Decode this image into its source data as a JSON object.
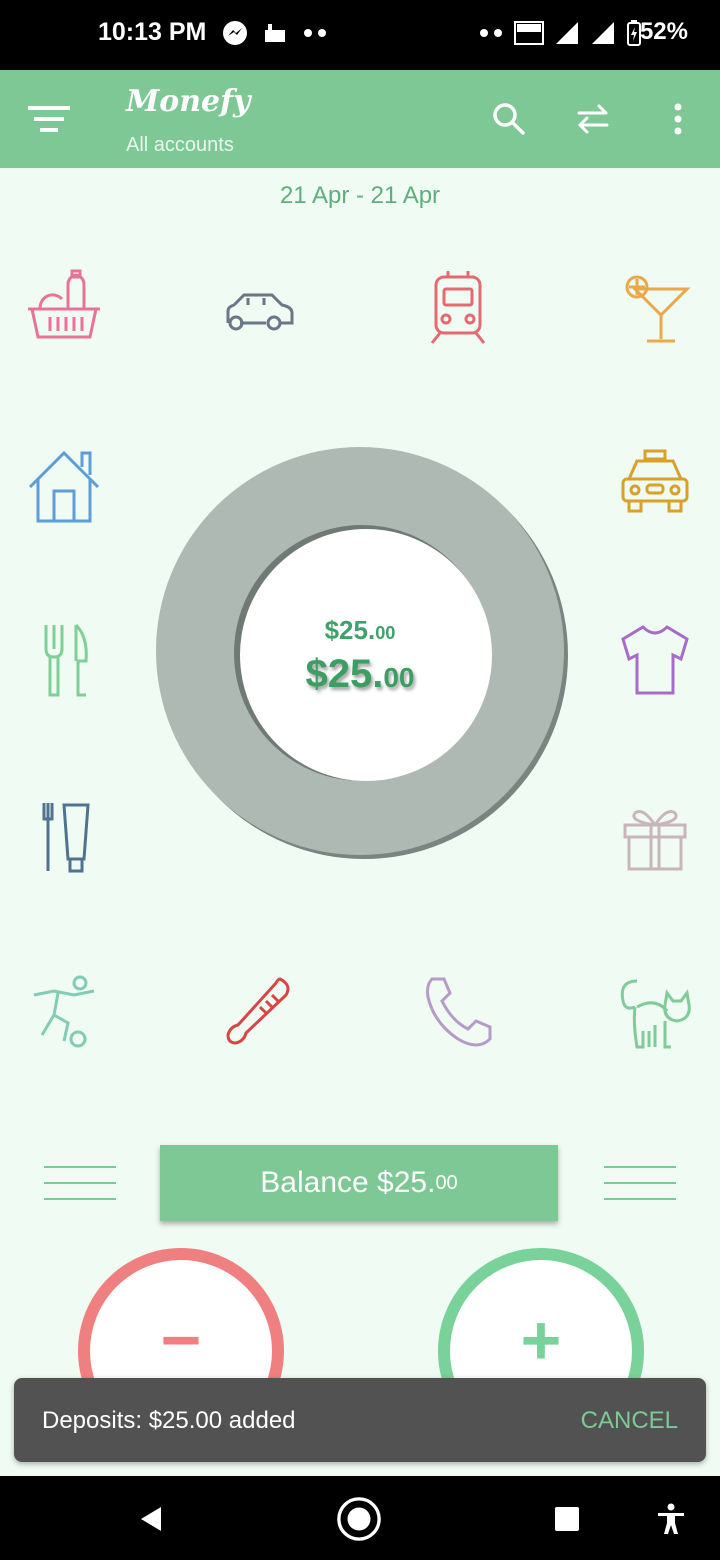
{
  "status_bar": {
    "time": "10:13 PM",
    "battery": "52%",
    "left_icons": [
      "messenger-icon",
      "notification-icon",
      "more-dots-icon"
    ],
    "right_icons": [
      "more-dots-icon",
      "volte-icon",
      "signal-icon",
      "signal-icon",
      "battery-charging-icon"
    ]
  },
  "app_bar": {
    "title": "Monefy",
    "subtitle": "All accounts",
    "actions": [
      "search-icon",
      "transfer-icon",
      "more-vert-icon"
    ]
  },
  "date_range": "21 Apr - 21 Apr",
  "categories": [
    {
      "name": "groceries",
      "icon": "basket-icon",
      "color": "#e8739a"
    },
    {
      "name": "car",
      "icon": "car-icon",
      "color": "#6b7689"
    },
    {
      "name": "transport",
      "icon": "train-icon",
      "color": "#e46a72"
    },
    {
      "name": "entertainment",
      "icon": "cocktail-icon",
      "color": "#eba84a"
    },
    {
      "name": "house",
      "icon": "house-icon",
      "color": "#5e9ed6"
    },
    {
      "name": "taxi",
      "icon": "taxi-icon",
      "color": "#d9a02a"
    },
    {
      "name": "eating-out",
      "icon": "fork-knife-icon",
      "color": "#7fcf97"
    },
    {
      "name": "clothes",
      "icon": "shirt-icon",
      "color": "#a86cc8"
    },
    {
      "name": "toiletry",
      "icon": "toothbrush-icon",
      "color": "#517392"
    },
    {
      "name": "gifts",
      "icon": "gift-icon",
      "color": "#c9b6bd"
    },
    {
      "name": "sports",
      "icon": "football-player-icon",
      "color": "#83cbb6"
    },
    {
      "name": "health",
      "icon": "thermometer-icon",
      "color": "#d94444"
    },
    {
      "name": "communications",
      "icon": "phone-icon",
      "color": "#b79ac8"
    },
    {
      "name": "pets",
      "icon": "cat-icon",
      "color": "#7fcb9a"
    }
  ],
  "center": {
    "amount_main": "$25.",
    "amount_cents": "00",
    "balance_main": "$25.",
    "balance_cents": "00"
  },
  "balance_button": {
    "label": "Balance $25.",
    "cents": "00"
  },
  "buttons": {
    "minus": "−",
    "plus": "+"
  },
  "snackbar": {
    "message": "Deposits: $25.00 added",
    "action": "CANCEL"
  },
  "colors": {
    "accent": "#7ec896",
    "expense": "#f08080",
    "income": "#78d29a",
    "ring": "#aeb9b3",
    "background": "#effbf3"
  }
}
